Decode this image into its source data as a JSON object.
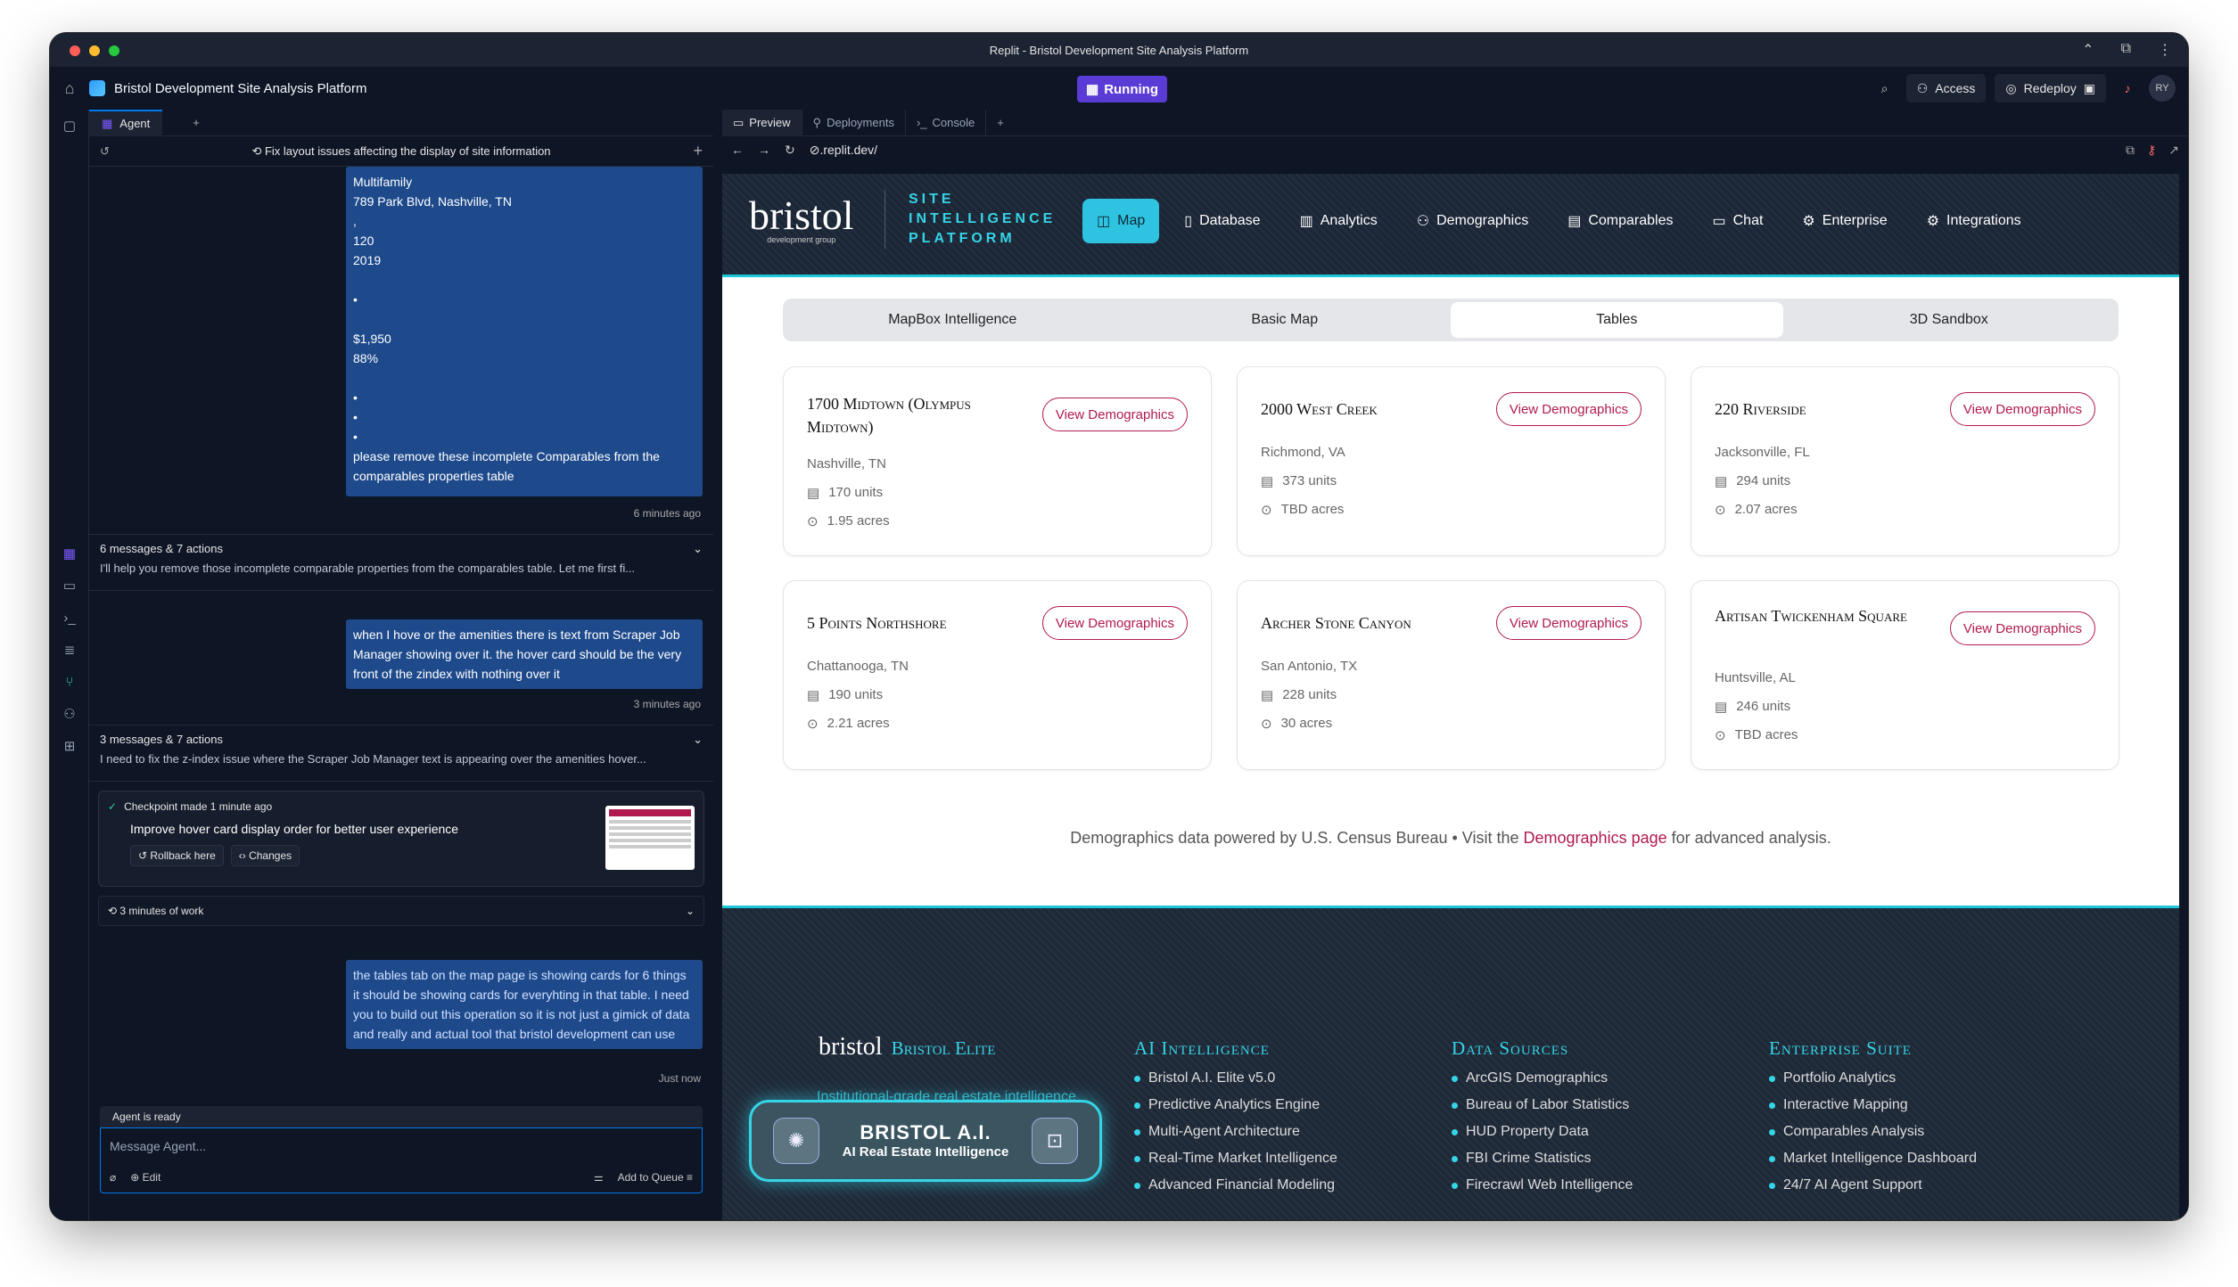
{
  "window": {
    "title": "Replit - Bristol Development Site Analysis Platform"
  },
  "app": {
    "project": "Bristol Development Site Analysis Platform",
    "status": "Running",
    "access": "Access",
    "redeploy": "Redeploy",
    "avatar": "RY"
  },
  "agent": {
    "tab": "Agent",
    "task": "Fix layout issues affecting the display of site information",
    "msg1": [
      "Multifamily",
      "789 Park Blvd, Nashville, TN",
      ",",
      "120",
      "2019",
      "•",
      "$1,950",
      "88%",
      "•",
      "•",
      "•",
      "please remove these incomplete Comparables from the comparables properties table"
    ],
    "msg1_time": "6 minutes ago",
    "a1_title": "6 messages & 7 actions",
    "a1_text": "I'll help you remove those incomplete comparable properties from the comparables table. Let me first fi...",
    "msg2": "when I hove or the amenities there is text from Scraper Job Manager showing over it. the hover card should be the very front of the zindex with nothing over it",
    "msg2_time": "3 minutes ago",
    "a2_title": "3 messages & 7 actions",
    "a2_text": "I need to fix the z-index issue where the Scraper Job Manager text is appearing over the amenities hover...",
    "cp_title": "Checkpoint made 1 minute ago",
    "cp_summary": "Improve hover card display order for better user experience",
    "rollback": "Rollback here",
    "changes": "Changes",
    "work": "3 minutes of work",
    "msg3": "the tables tab on the map page is showing cards for 6 things it should be showing cards for everyhting in that table. I need you to build out this operation so it is not just a gimick of data and really and actual tool that bristol development can use",
    "msg3_time": "Just now",
    "ready": "Agent is ready",
    "placeholder": "Message Agent...",
    "edit": "Edit",
    "queue": "Add to Queue"
  },
  "preview": {
    "tabs": [
      "Preview",
      "Deployments",
      "Console"
    ],
    "url": ".replit.dev/"
  },
  "site": {
    "logo": "bristol",
    "logo_sub": "development group",
    "platform": [
      "SITE",
      "INTELLIGENCE",
      "PLATFORM"
    ],
    "nav": [
      "Map",
      "Database",
      "Analytics",
      "Demographics",
      "Comparables",
      "Chat",
      "Enterprise",
      "Integrations"
    ],
    "subtabs": [
      "MapBox Intelligence",
      "Basic Map",
      "Tables",
      "3D Sandbox"
    ],
    "button": "View Demographics",
    "cards": [
      {
        "name": "1700 Midtown (Olympus Midtown)",
        "loc": "Nashville, TN",
        "units": "170 units",
        "acres": "1.95 acres"
      },
      {
        "name": "2000 West Creek",
        "loc": "Richmond, VA",
        "units": "373 units",
        "acres": "TBD acres"
      },
      {
        "name": "220 Riverside",
        "loc": "Jacksonville, FL",
        "units": "294 units",
        "acres": "2.07 acres"
      },
      {
        "name": "5 Points Northshore",
        "loc": "Chattanooga, TN",
        "units": "190 units",
        "acres": "2.21 acres"
      },
      {
        "name": "Archer Stone Canyon",
        "loc": "San Antonio, TX",
        "units": "228 units",
        "acres": "30 acres"
      },
      {
        "name": "Artisan Twickenham Square",
        "loc": "Huntsville, AL",
        "units": "246 units",
        "acres": "TBD acres"
      }
    ],
    "note_a": "Demographics data powered by U.S. Census Bureau • Visit the ",
    "note_link": "Demographics page",
    "note_b": " for advanced analysis.",
    "footer": {
      "brand": "Bristol Elite",
      "tagline": "Institutional-grade real estate intelligence decisions.",
      "bai_title": "BRISTOL A.I.",
      "bai_sub": "AI Real Estate Intelligence",
      "cols": [
        {
          "title": "AI Intelligence",
          "items": [
            "Bristol A.I. Elite v5.0",
            "Predictive Analytics Engine",
            "Multi-Agent Architecture",
            "Real-Time Market Intelligence",
            "Advanced Financial Modeling"
          ]
        },
        {
          "title": "Data Sources",
          "items": [
            "ArcGIS Demographics",
            "Bureau of Labor Statistics",
            "HUD Property Data",
            "FBI Crime Statistics",
            "Firecrawl Web Intelligence"
          ]
        },
        {
          "title": "Enterprise Suite",
          "items": [
            "Portfolio Analytics",
            "Interactive Mapping",
            "Comparables Analysis",
            "Market Intelligence Dashboard",
            "24/7 AI Agent Support"
          ]
        }
      ]
    }
  }
}
